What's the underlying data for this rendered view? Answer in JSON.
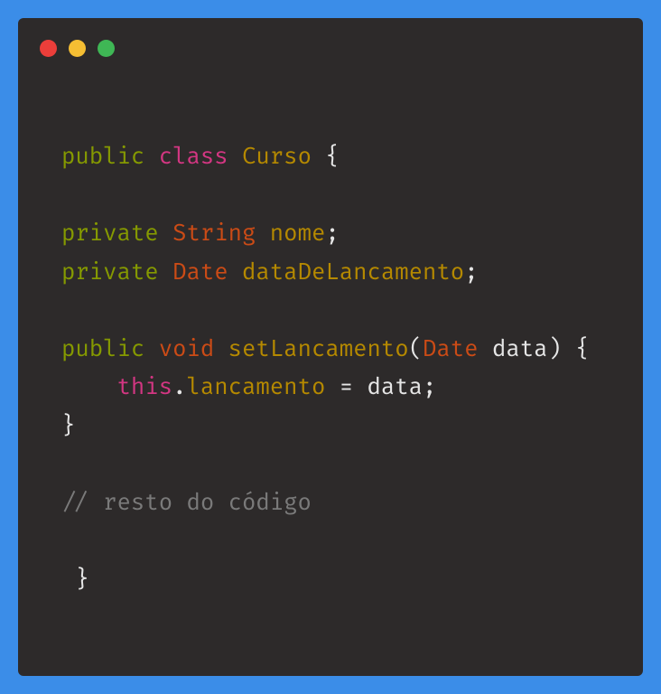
{
  "colors": {
    "background": "#3b8de8",
    "window": "#2d2a2a",
    "red": "#ec3e3a",
    "yellow": "#f5be33",
    "green": "#3fb755"
  },
  "code": {
    "line1": {
      "public": "public",
      "class": "class",
      "classname": "Curso",
      "brace": " {"
    },
    "line3": {
      "private": "private",
      "type": "String",
      "name": "nome",
      "semi": ";"
    },
    "line4": {
      "private": "private",
      "type": "Date",
      "name": "dataDeLancamento",
      "semi": ";"
    },
    "line6": {
      "public": "public",
      "void": "void",
      "method": "setLancamento",
      "lparen": "(",
      "paramtype": "Date",
      "paramname": " data",
      "rparen": ")",
      "brace": " {"
    },
    "line7": {
      "indent": "    ",
      "this": "this",
      "dot": ".",
      "field": "lancamento",
      "rest": " = data;"
    },
    "line8": {
      "brace": "}"
    },
    "line10": {
      "comment": "// resto do código"
    },
    "line12": {
      "brace": " }"
    }
  }
}
